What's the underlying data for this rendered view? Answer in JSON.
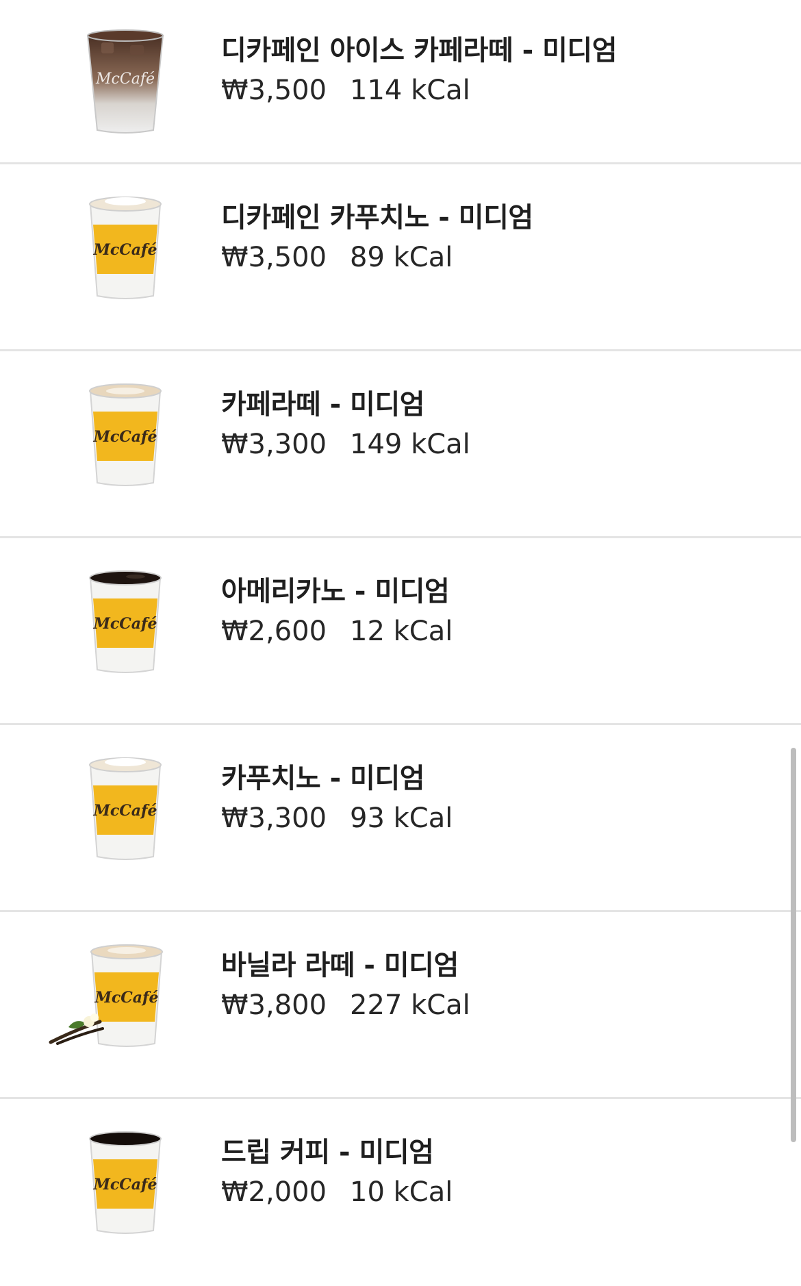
{
  "brand_text": "McCafé",
  "colors": {
    "sleeve": "#f2b71e",
    "divider": "#e4e4e4",
    "text": "#222222",
    "scrollbar": "#bdbdbd"
  },
  "menu": {
    "items": [
      {
        "name": "디카페인 아이스 카페라떼 - 미디엄",
        "price": "₩3,500",
        "calories": "114 kCal",
        "image": "iced-latte-cup-icon"
      },
      {
        "name": "디카페인 카푸치노 - 미디엄",
        "price": "₩3,500",
        "calories": "89 kCal",
        "image": "cappuccino-cup-icon"
      },
      {
        "name": "카페라떼 - 미디엄",
        "price": "₩3,300",
        "calories": "149 kCal",
        "image": "latte-cup-icon"
      },
      {
        "name": "아메리카노 - 미디엄",
        "price": "₩2,600",
        "calories": "12 kCal",
        "image": "americano-cup-icon"
      },
      {
        "name": "카푸치노 - 미디엄",
        "price": "₩3,300",
        "calories": "93 kCal",
        "image": "cappuccino-cup-icon"
      },
      {
        "name": "바닐라 라떼 - 미디엄",
        "price": "₩3,800",
        "calories": "227 kCal",
        "image": "vanilla-latte-cup-icon"
      },
      {
        "name": "드립 커피 - 미디엄",
        "price": "₩2,000",
        "calories": "10 kCal",
        "image": "drip-coffee-cup-icon"
      }
    ]
  }
}
